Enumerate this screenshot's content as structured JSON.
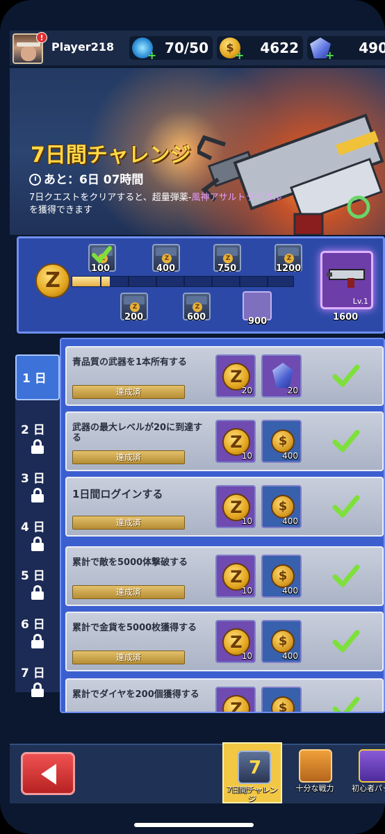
{
  "player": {
    "name": "Player218",
    "alert": "!"
  },
  "resources": {
    "energy": "70/50",
    "gold": "4622",
    "gems": "490"
  },
  "banner": {
    "title": "7日間チャレンジ",
    "timer": "あと：6日 07時間",
    "desc_before": "7日クエストをクリアすると、超量弾薬-",
    "desc_highlight": "風神アサルトライフル",
    "desc_after": "を獲得できます"
  },
  "progress": {
    "fill_fraction": 0.17,
    "milestones_top": [
      "100",
      "400",
      "750",
      "1200"
    ],
    "milestones_bottom": [
      "200",
      "600",
      "900"
    ],
    "final": {
      "value": "1600",
      "level": "Lv.1"
    }
  },
  "days": [
    {
      "label": "1 日",
      "locked": false
    },
    {
      "label": "2 日",
      "locked": true
    },
    {
      "label": "3 日",
      "locked": true
    },
    {
      "label": "4 日",
      "locked": true
    },
    {
      "label": "5 日",
      "locked": true
    },
    {
      "label": "6 日",
      "locked": true
    },
    {
      "label": "7 日",
      "locked": true
    }
  ],
  "quests": [
    {
      "title": "青品質の武器を1本所有する",
      "status": "達成済",
      "r1": "20",
      "r2": "20",
      "r2type": "gem"
    },
    {
      "title": "武器の最大レベルが20に到達する",
      "status": "達成済",
      "r1": "10",
      "r2": "400",
      "r2type": "gold"
    },
    {
      "title": "1日間ログインする",
      "status": "達成済",
      "r1": "10",
      "r2": "400",
      "r2type": "gold"
    },
    {
      "title": "累計で敵を5000体撃破する",
      "status": "達成済",
      "r1": "10",
      "r2": "400",
      "r2type": "gold"
    },
    {
      "title": "累計で金貨を5000枚獲得する",
      "status": "達成済",
      "r1": "10",
      "r2": "400",
      "r2type": "gold"
    },
    {
      "title": "累計でダイヤを200個獲得する",
      "status": "",
      "r1": "",
      "r2": "",
      "r2type": "gold"
    }
  ],
  "bottom_tabs": [
    {
      "label": "7日間チャレンジ"
    },
    {
      "label": "十分な戦力"
    },
    {
      "label": "初心者パック"
    }
  ],
  "colors": {
    "accent": "#ffd84a",
    "check": "#7ee03a",
    "panel": "#3c5fcf"
  }
}
